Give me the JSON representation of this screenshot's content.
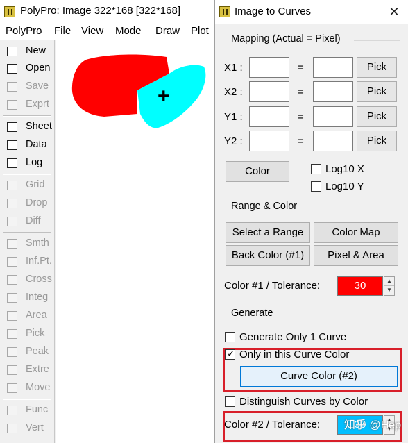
{
  "main": {
    "title": "PolyPro: Image 322*168 [322*168]",
    "menu": [
      "PolyPro",
      "File",
      "View",
      "Mode",
      "Draw",
      "Plot"
    ],
    "tools": [
      {
        "label": "New",
        "icon": "new-file-icon",
        "enabled": true
      },
      {
        "label": "Open",
        "icon": "open-folder-icon",
        "enabled": true
      },
      {
        "label": "Save",
        "icon": "save-disk-icon",
        "enabled": false
      },
      {
        "label": "Exprt",
        "icon": "export-icon",
        "enabled": false
      },
      {
        "label": "Sheet",
        "icon": "sheet-icon",
        "enabled": true
      },
      {
        "label": "Data",
        "icon": "data-table-icon",
        "enabled": true
      },
      {
        "label": "Log",
        "icon": "log-icon",
        "enabled": true
      },
      {
        "label": "Grid",
        "icon": "grid-icon",
        "enabled": false
      },
      {
        "label": "Drop",
        "icon": "drop-icon",
        "enabled": false
      },
      {
        "label": "Diff",
        "icon": "diff-icon",
        "enabled": false
      },
      {
        "label": "Smth",
        "icon": "smooth-icon",
        "enabled": false
      },
      {
        "label": "Inf.Pt.",
        "icon": "inflection-point-icon",
        "enabled": false
      },
      {
        "label": "Cross",
        "icon": "cross-icon",
        "enabled": false
      },
      {
        "label": "Integ",
        "icon": "integrate-icon",
        "enabled": false
      },
      {
        "label": "Area",
        "icon": "area-icon",
        "enabled": false
      },
      {
        "label": "Pick",
        "icon": "pick-icon",
        "enabled": false
      },
      {
        "label": "Peak",
        "icon": "peak-icon",
        "enabled": false
      },
      {
        "label": "Extre",
        "icon": "extreme-icon",
        "enabled": false
      },
      {
        "label": "Move",
        "icon": "move-icon",
        "enabled": false
      },
      {
        "label": "Func",
        "icon": "function-icon",
        "enabled": false
      },
      {
        "label": "Vert",
        "icon": "vertical-icon",
        "enabled": false
      }
    ],
    "canvas_colors": {
      "red_blob": "#ff0000",
      "cyan_blob": "#00ffff"
    }
  },
  "dialog": {
    "title": "Image to Curves",
    "close_glyph": "✕",
    "mapping": {
      "label": "Mapping (Actual = Pixel)",
      "equals": "=",
      "rows": [
        {
          "label": "X1 :",
          "actual": "",
          "pixel": "",
          "pick": "Pick"
        },
        {
          "label": "X2 :",
          "actual": "",
          "pixel": "",
          "pick": "Pick"
        },
        {
          "label": "Y1 :",
          "actual": "",
          "pixel": "",
          "pick": "Pick"
        },
        {
          "label": "Y2 :",
          "actual": "",
          "pixel": "",
          "pick": "Pick"
        }
      ],
      "color_button": "Color",
      "log10x": {
        "label": "Log10 X",
        "checked": false
      },
      "log10y": {
        "label": "Log10 Y",
        "checked": false
      }
    },
    "range_color": {
      "label": "Range & Color",
      "select_range": "Select a Range",
      "color_map": "Color Map",
      "back_color": "Back Color (#1)",
      "pixel_area": "Pixel & Area",
      "color1_label": "Color #1 / Tolerance:",
      "color1_value": "30",
      "color1_swatch": "#ff0000"
    },
    "generate": {
      "label": "Generate",
      "only1": {
        "label": "Generate Only 1 Curve",
        "checked": false
      },
      "only_color": {
        "label": "Only in this Curve Color",
        "checked": true
      },
      "curve_color_button": "Curve Color (#2)",
      "distinguish": {
        "label": "Distinguish Curves by Color",
        "checked": false
      },
      "color2_label": "Color #2 / Tolerance:",
      "color2_value": "30",
      "color2_swatch": "#00bfff"
    },
    "check_glyph": "✓"
  },
  "watermark": "知乎 @Hep",
  "highlight_color": "#d81f2a"
}
